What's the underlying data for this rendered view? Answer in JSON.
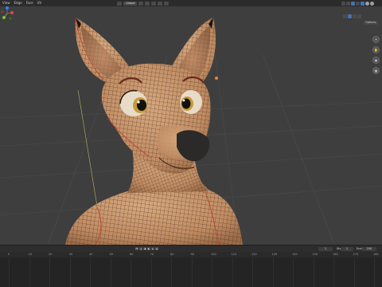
{
  "topbar": {
    "menus": [
      "View",
      "Edge",
      "Face",
      "UV"
    ],
    "orientation": "Global"
  },
  "viewport": {
    "options_label": "Options",
    "gizmo_axes": [
      "X",
      "Y",
      "Z"
    ],
    "colors": {
      "background": "#3e3e3e",
      "grid": "#4a4a4a",
      "skin": "#c99870",
      "wire": "#3a2418",
      "seam": "#c0392b",
      "eye": "#e7dcc7",
      "nose": "#2a2a2a"
    }
  },
  "timeline": {
    "current_frame": "1",
    "start_label": "Start",
    "start_frame": "1",
    "end_label": "End",
    "end_frame": "250",
    "ruler_ticks": [
      "0",
      "10",
      "20",
      "30",
      "40",
      "50",
      "60",
      "70",
      "80",
      "90",
      "100",
      "110",
      "120",
      "130",
      "140",
      "150",
      "160",
      "170",
      "180",
      "190"
    ]
  }
}
